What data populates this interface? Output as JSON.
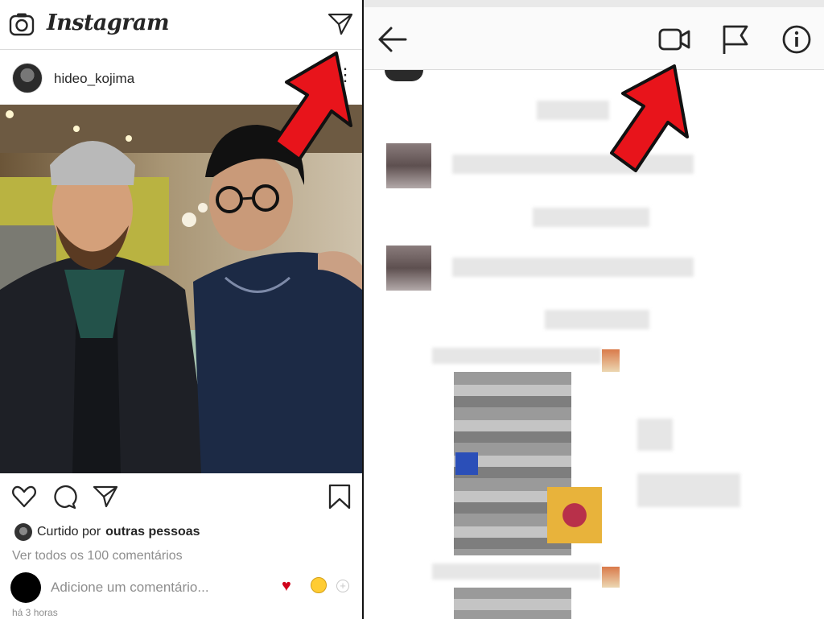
{
  "left": {
    "app_name": "Instagram",
    "post": {
      "username": "hideo_kojima",
      "liked_prefix": "Curtido por",
      "liked_by": "outras pessoas",
      "view_comments": "Ver todos os 100 comentários",
      "comment_placeholder": "Adicione um comentário...",
      "timestamp": "há 3 horas"
    },
    "icons": [
      "camera-icon",
      "direct-message-icon",
      "more-options-icon",
      "heart-icon",
      "comment-icon",
      "share-icon",
      "bookmark-icon"
    ]
  },
  "right": {
    "icons": [
      "back-arrow-icon",
      "video-call-icon",
      "flag-icon",
      "info-icon"
    ]
  },
  "annotations": {
    "arrow_color": "#e8141b"
  }
}
